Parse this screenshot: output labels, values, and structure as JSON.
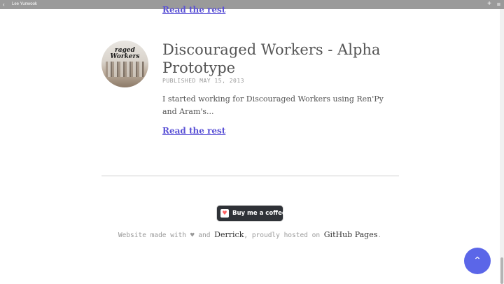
{
  "window": {
    "title": "Lee Yunwook",
    "back_icon": "chevron-left-icon",
    "plus_icon": "plus-icon",
    "menu_icon": "menu-icon"
  },
  "previous_post": {
    "read_more": "Read the rest"
  },
  "post": {
    "thumbnail_text": "raged Workers",
    "title": "Discouraged Workers - Alpha Prototype",
    "date": "PUBLISHED MAY 15, 2013",
    "excerpt": "I started working for Discouraged Workers using Ren'Py and Aram's...",
    "read_more": "Read the rest"
  },
  "footer": {
    "coffee_label": "Buy me a coffee",
    "coffee_icon": "coffee-cup-icon",
    "text_prefix": "Website made with ",
    "heart": "♥",
    "text_and": " and ",
    "link_derrick": "Derrick",
    "text_hosted": ", proudly hosted on ",
    "link_github": "GitHub Pages",
    "text_suffix": "."
  },
  "scroll_top": {
    "icon": "chevron-up-icon"
  },
  "colors": {
    "link": "#5b52d6",
    "scroll_button": "#5b66e8",
    "topbar": "#9a9a9a"
  }
}
